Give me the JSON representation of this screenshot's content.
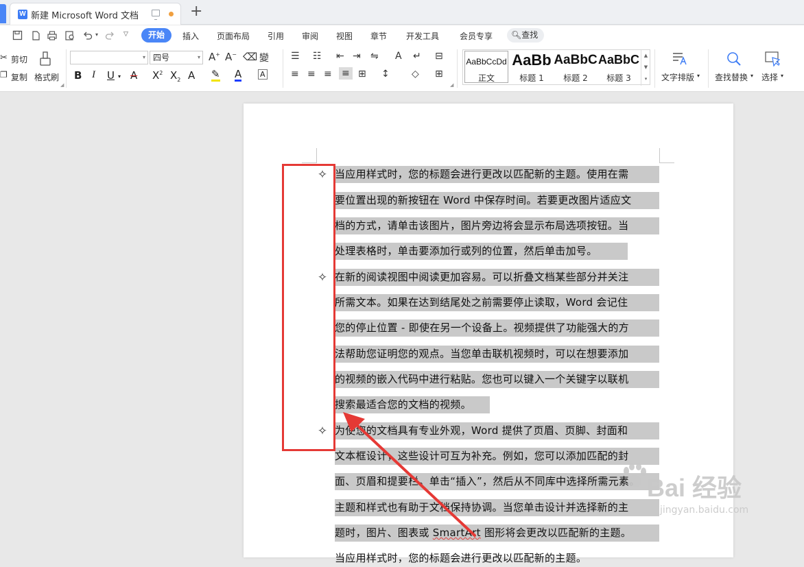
{
  "window": {
    "tab_title": "新建 Microsoft Word 文档",
    "w_icon": "W",
    "new_tab": "+"
  },
  "menu": {
    "items": [
      "开始",
      "插入",
      "页面布局",
      "引用",
      "审阅",
      "视图",
      "章节",
      "开发工具",
      "会员专享"
    ],
    "active": "开始",
    "search": "查找"
  },
  "ribbon": {
    "cut": "剪切",
    "copy": "复制",
    "format_painter": "格式刷",
    "font_name": "",
    "font_size": "四号",
    "styles": [
      {
        "sample": "AaBbCcDd",
        "name": "正文"
      },
      {
        "sample": "AaBb",
        "name": "标题 1"
      },
      {
        "sample": "AaBbC",
        "name": "标题 2"
      },
      {
        "sample": "AaBbC",
        "name": "标题 3"
      }
    ],
    "text_layout": "文字排版",
    "find_replace": "查找替换",
    "select": "选择"
  },
  "document": {
    "bullet_symbol": "✧",
    "lines": [
      "当应用样式时，您的标题会进行更改以匹配新的主题。使用在需",
      "要位置出现的新按钮在 Word 中保存时间。若要更改图片适应文",
      "档的方式，请单击该图片，图片旁边将会显示布局选项按钮。当",
      "处理表格时，单击要添加行或列的位置，然后单击加号。",
      "在新的阅读视图中阅读更加容易。可以折叠文档某些部分并关注",
      "所需文本。如果在达到结尾处之前需要停止读取，Word 会记住",
      "您的停止位置 - 即使在另一个设备上。视频提供了功能强大的方",
      "法帮助您证明您的观点。当您单击联机视频时，可以在想要添加",
      "的视频的嵌入代码中进行粘贴。您也可以键入一个关键字以联机",
      "搜索最适合您的文档的视频。",
      "为使您的文档具有专业外观，Word 提供了页眉、页脚、封面和",
      "文本框设计，这些设计可互为补充。例如，您可以添加匹配的封",
      "面、页眉和提要栏。单击“插入”，然后从不同库中选择所需元素。",
      "主题和样式也有助于文档保持协调。当您单击设计并选择新的主",
      "图形将会更改以匹配新的主题。",
      "当应用样式时，您的标题会进行更改以匹配新的主题。"
    ],
    "line14_prefix": "题时，图片、图表或 ",
    "line14_smartart": "SmartArt"
  },
  "watermark": {
    "big": "Bai  经验",
    "small": "jingyan.baidu.com"
  },
  "colors": {
    "accent": "#4a86f7",
    "highlight": "#c9c9c9",
    "annotation": "#e53935"
  }
}
